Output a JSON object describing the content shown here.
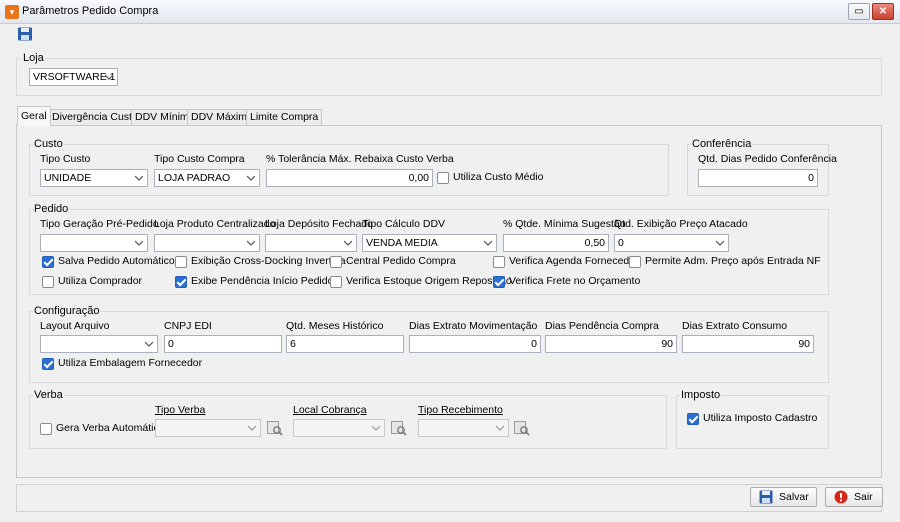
{
  "window": {
    "title": "Parâmetros Pedido Compra"
  },
  "toolbar": {
    "save_icon": "floppy-disk-icon"
  },
  "loja": {
    "group": "Loja",
    "value": "VRSOFTWARE 1"
  },
  "tabs": [
    "Geral",
    "Divergência Custo",
    "DDV Mínimo",
    "DDV Máximo",
    "Limite Compra"
  ],
  "custo": {
    "group": "Custo",
    "tipo_custo_label": "Tipo Custo",
    "tipo_custo_value": "UNIDADE",
    "tipo_custo_compra_label": "Tipo Custo Compra",
    "tipo_custo_compra_value": "LOJA PADRAO",
    "tolerancia_label": "% Tolerância Máx. Rebaixa Custo Verba",
    "tolerancia_value": "0,00",
    "utiliza_custo_medio": "Utiliza Custo Médio"
  },
  "conferencia": {
    "group": "Conferência",
    "dias_label": "Qtd. Dias Pedido Conferência",
    "dias_value": "0"
  },
  "pedido": {
    "group": "Pedido",
    "tipo_geracao_label": "Tipo Geração Pré-Pedido",
    "tipo_geracao_value": "",
    "loja_produto_label": "Loja Produto Centralizado",
    "loja_produto_value": "",
    "loja_deposito_label": "Loja Depósito Fechado",
    "loja_deposito_value": "",
    "tipo_calculo_label": "Tipo Cálculo DDV",
    "tipo_calculo_value": "VENDA MEDIA",
    "qtde_minima_label": "% Qtde. Mínima Sugestão",
    "qtde_minima_value": "0,50",
    "qtd_exibicao_label": "Qtd. Exibição Preço Atacado",
    "qtd_exibicao_value": "0",
    "checks": [
      {
        "label": "Salva Pedido Automático",
        "checked": true
      },
      {
        "label": "Exibição Cross-Docking Invertida",
        "checked": false
      },
      {
        "label": "Central Pedido Compra",
        "checked": false
      },
      {
        "label": "Verifica Agenda Fornecedor",
        "checked": false
      },
      {
        "label": "Permite Adm. Preço após Entrada NF",
        "checked": false
      },
      {
        "label": "Utiliza Comprador",
        "checked": false
      },
      {
        "label": "Exibe Pendência Início Pedido",
        "checked": true
      },
      {
        "label": "Verifica Estoque Origem Reposição",
        "checked": false
      },
      {
        "label": "Verifica Frete no Orçamento",
        "checked": true
      }
    ]
  },
  "configuracao": {
    "group": "Configuração",
    "layout_label": "Layout Arquivo",
    "layout_value": "",
    "cnpj_label": "CNPJ EDI",
    "cnpj_value": "0",
    "meses_label": "Qtd. Meses Histórico",
    "meses_value": "6",
    "extrato_mov_label": "Dias Extrato Movimentação",
    "extrato_mov_value": "0",
    "pendencia_label": "Dias Pendência Compra",
    "pendencia_value": "90",
    "extrato_cons_label": "Dias Extrato Consumo",
    "extrato_cons_value": "90",
    "utiliza_embalagem": "Utiliza Embalagem Fornecedor"
  },
  "verba": {
    "group": "Verba",
    "gera_verba": "Gera Verba Automática",
    "tipo_verba_label": "Tipo Verba",
    "local_cobranca_label": "Local Cobrança",
    "tipo_recebimento_label": "Tipo Recebimento"
  },
  "imposto": {
    "group": "Imposto",
    "utiliza_imposto": "Utiliza Imposto Cadastro"
  },
  "buttons": {
    "salvar": "Salvar",
    "sair": "Sair"
  },
  "colors": {
    "accent": "#2c6fd1",
    "close": "#c9422e",
    "app_icon": "#e9741a"
  }
}
